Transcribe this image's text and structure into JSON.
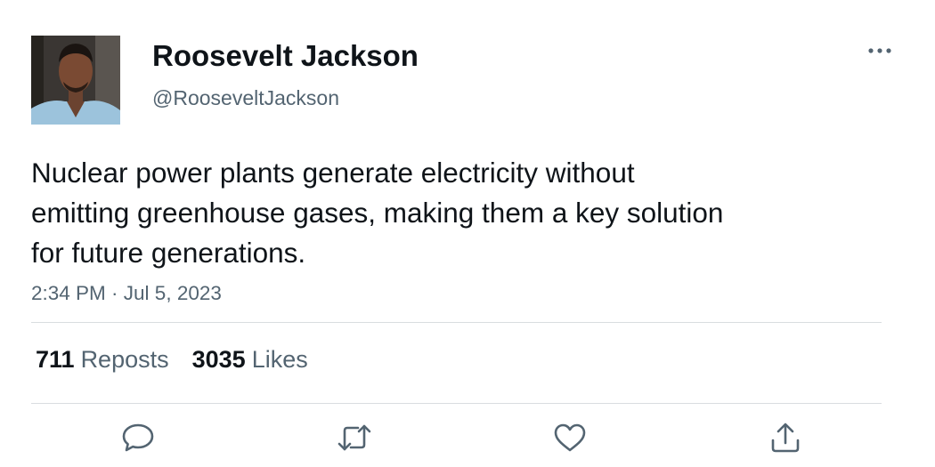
{
  "author": {
    "display_name": "Roosevelt Jackson",
    "handle": "@RooseveltJackson"
  },
  "tweet": {
    "text_lines": [
      "Nuclear power plants generate electricity without",
      "emitting greenhouse gases, making them a key solution",
      "for future generations."
    ],
    "timestamp": "2:34 PM · Jul 5, 2023"
  },
  "stats": {
    "reposts_count": "711",
    "reposts_label": "Reposts",
    "likes_count": "3035",
    "likes_label": "Likes"
  },
  "icons": {
    "more": "more-horizontal-icon",
    "reply": "reply-icon",
    "repost": "repost-icon",
    "like": "heart-icon",
    "share": "share-icon"
  },
  "colors": {
    "text_primary": "#0f1419",
    "text_secondary": "#536471",
    "divider": "#d9dde0"
  }
}
